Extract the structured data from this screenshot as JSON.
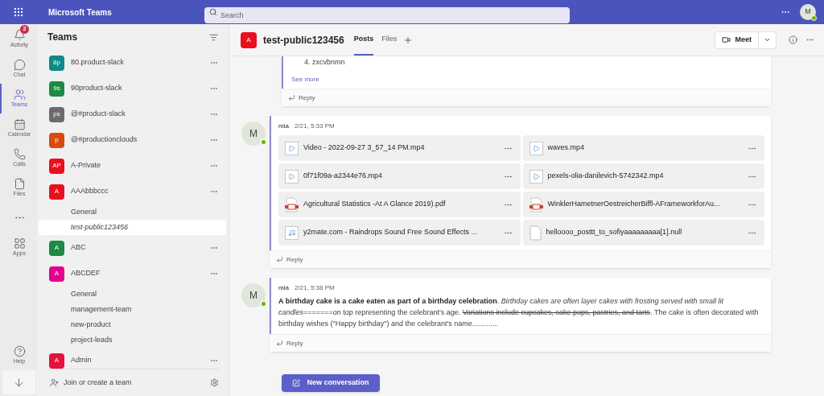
{
  "app": {
    "title": "Microsoft Teams",
    "search_placeholder": "Search",
    "avatar": "M"
  },
  "rail": [
    {
      "label": "Activity",
      "badge": "2",
      "selected": false
    },
    {
      "label": "Chat",
      "selected": false
    },
    {
      "label": "Teams",
      "selected": true
    },
    {
      "label": "Calendar",
      "selected": false
    },
    {
      "label": "Calls",
      "selected": false
    },
    {
      "label": "Files",
      "selected": false
    },
    {
      "selected": false
    },
    {
      "label": "Apps",
      "selected": false
    }
  ],
  "rail_bottom": [
    {
      "label": "Help"
    }
  ],
  "teams_panel": {
    "title": "Teams",
    "join": "Join or create a team",
    "teams": [
      {
        "name": "80.product-slack",
        "initials": "8p",
        "color": "#0f8a86"
      },
      {
        "name": "90product-slack",
        "initials": "9s",
        "color": "#1e8a44"
      },
      {
        "name": "@#product-slack",
        "initials": "ps",
        "color": "#6b6b6b"
      },
      {
        "name": "@#productionclouds",
        "initials": "p",
        "color": "#da4a0c"
      },
      {
        "name": "A-Private",
        "initials": "AP",
        "color": "#e8101e"
      },
      {
        "name": "AAAbbbccc",
        "initials": "A",
        "color": "#e8101e",
        "children": [
          {
            "name": "General",
            "selected": false
          },
          {
            "name": "test-public123456",
            "selected": true
          }
        ]
      },
      {
        "name": "ABC",
        "initials": "A",
        "color": "#1e8a44"
      },
      {
        "name": "ABCDEF",
        "initials": "A",
        "color": "#e3008c",
        "children": [
          {
            "name": "General",
            "selected": false
          },
          {
            "name": "management-team",
            "selected": false
          },
          {
            "name": "new-product",
            "selected": false
          },
          {
            "name": "project-leads",
            "selected": false
          }
        ]
      },
      {
        "name": "Admin",
        "initials": "A",
        "color": "#e8103c"
      }
    ]
  },
  "channel": {
    "name": "test-public123456",
    "initials": "A",
    "color": "#e8101e",
    "tabs": [
      {
        "label": "Posts",
        "selected": true
      },
      {
        "label": "Files",
        "selected": false
      }
    ],
    "meet": "Meet"
  },
  "posts": [
    {
      "kind": "truncated",
      "lines": [
        "4. zxcvbnmn"
      ],
      "see_more": "See more",
      "reply": "Reply"
    },
    {
      "kind": "files",
      "author": "mia",
      "avatar": "M",
      "time": "2/21, 5:33 PM",
      "reply": "Reply",
      "files": [
        {
          "name": "Video - 2022-09-27 3_57_14 PM.mp4",
          "kind": "video"
        },
        {
          "name": "waves.mp4",
          "kind": "video"
        },
        {
          "name": "0f71f09a-a2344e76.mp4",
          "kind": "video"
        },
        {
          "name": "pexels-olia-danilevich-5742342.mp4",
          "kind": "video"
        },
        {
          "name": "Agricultural Statistics -At A Glance 2019).pdf",
          "kind": "pdf"
        },
        {
          "name": "WinklerHametnerOestreicherBiffl-AFrameworkforAu...",
          "kind": "pdf"
        },
        {
          "name": "y2mate.com - Raindrops Sound Free Sound Effects ...",
          "kind": "audio"
        },
        {
          "name": "helloooo_posttt_to_sofiyaaaaaaaaa[1].null",
          "kind": "generic"
        }
      ]
    },
    {
      "kind": "text",
      "author": "mia",
      "avatar": "M",
      "time": "2/21, 5:38 PM",
      "reply": "Reply",
      "segments": [
        {
          "kind": "bold",
          "text": "A birthday cake is a cake eaten as part of a birthday celebration"
        },
        {
          "kind": "plain",
          "text": ". "
        },
        {
          "kind": "italic",
          "text": "Birthday cakes are often layer cakes with frosting served with small lit candles"
        },
        {
          "kind": "plain",
          "text": "=======on top representing the celebrant's age. "
        },
        {
          "kind": "strike",
          "text": "Variations include cupcakes, cake pops, pastries, and tarts"
        },
        {
          "kind": "plain",
          "text": ". The cake is often decorated with birthday wishes (\"Happy birthday\") and the celebrant's name............."
        }
      ]
    }
  ],
  "new_conversation": "New conversation"
}
